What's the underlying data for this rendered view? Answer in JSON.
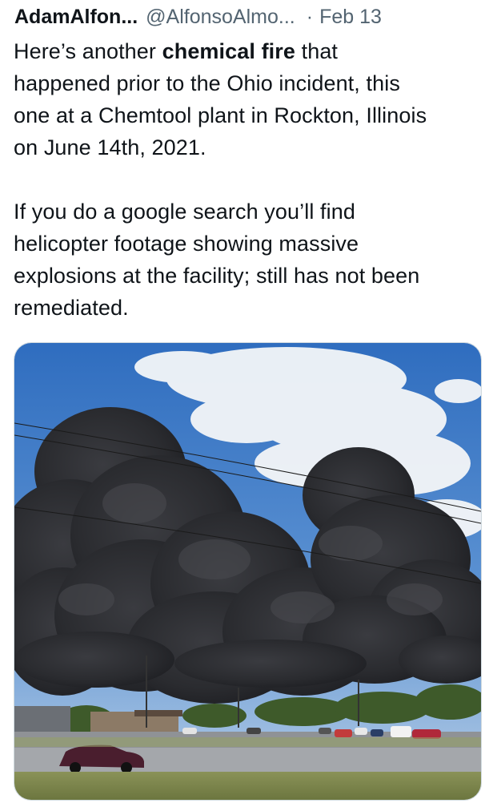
{
  "tweet": {
    "display_name": "AdamAlfon...",
    "handle": "@AlfonsoAlmo...",
    "separator": "·",
    "date": "Feb 13",
    "body": {
      "line1_pre": "Here’s another ",
      "line1_bold": "chemical fire",
      "line1_post": " that",
      "line2": "happened prior to the Ohio incident, this",
      "line3": "one at a Chemtool plant in Rockton, Illinois",
      "line4": "on June 14th, 2021.",
      "line5": "If you do a google search you’ll find",
      "line6": "helicopter footage showing massive",
      "line7": "explosions at the facility; still has not been",
      "line8": "remediated."
    },
    "media": {
      "type": "photo"
    }
  },
  "colors": {
    "text_primary": "#0f1419",
    "text_secondary": "#536471",
    "media_border": "#cfd9de",
    "sky": "#3f7cc8",
    "smoke": "#2b2c30",
    "grass": "#7f8a4f"
  }
}
